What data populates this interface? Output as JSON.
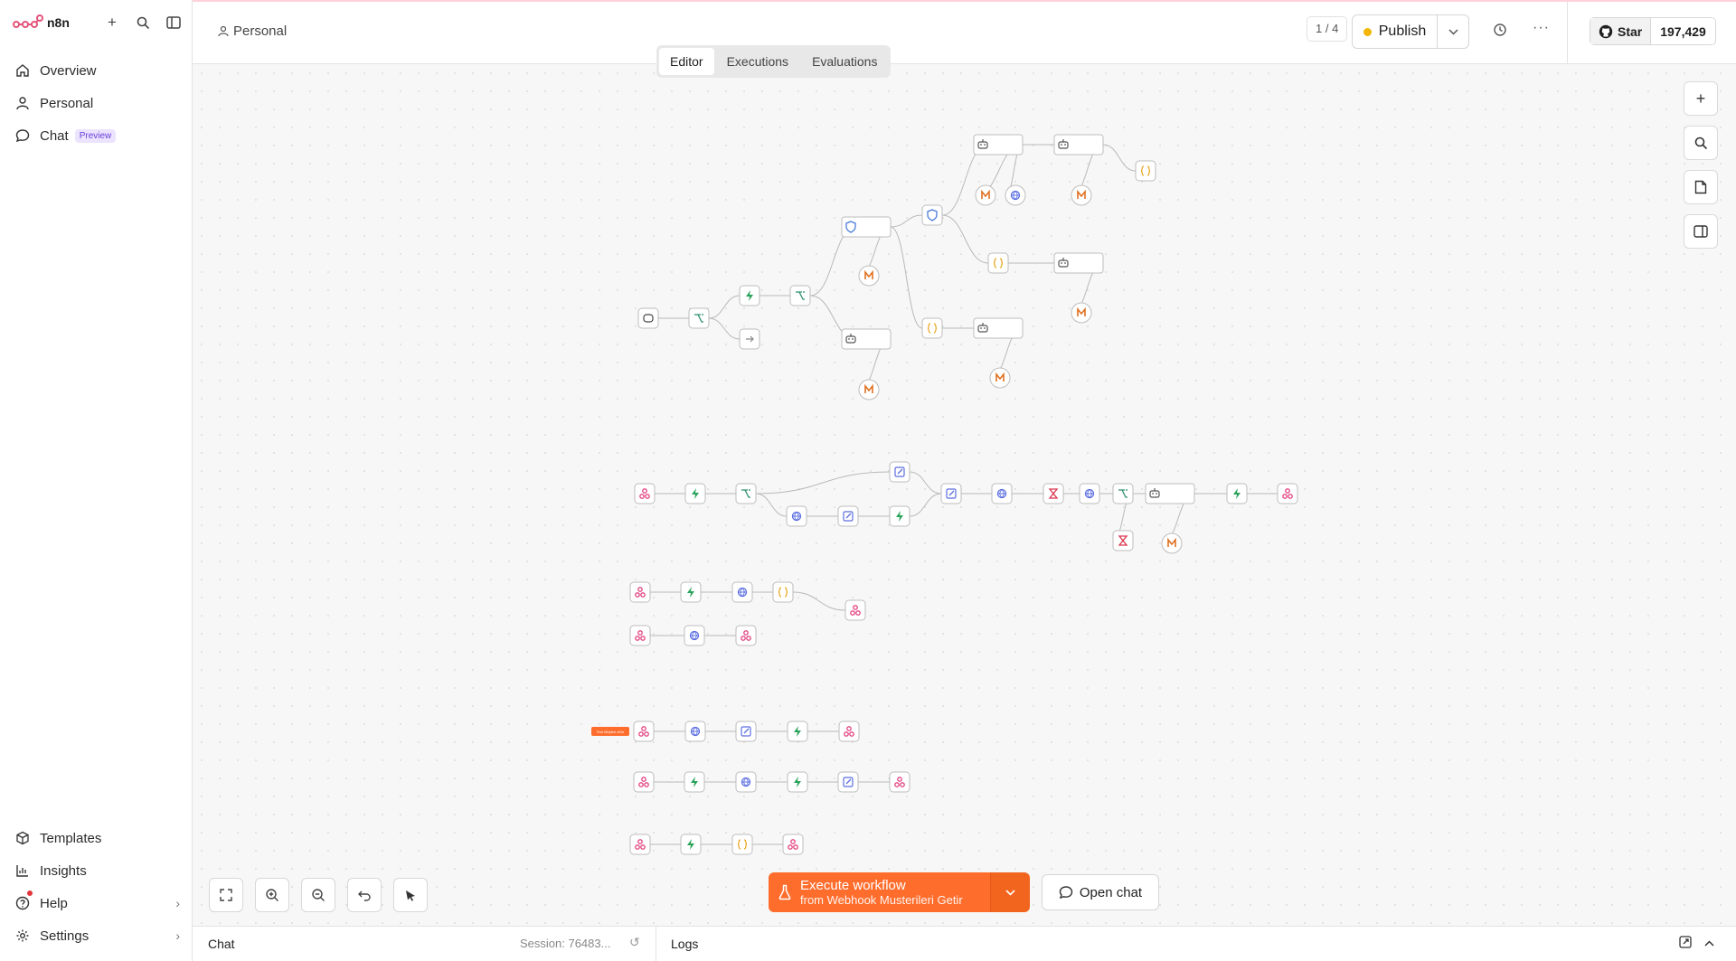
{
  "app": {
    "name": "n8n"
  },
  "sidebar": {
    "items": [
      {
        "label": "Overview",
        "icon": "home-icon"
      },
      {
        "label": "Personal",
        "icon": "user-icon"
      },
      {
        "label": "Chat",
        "icon": "chat-icon",
        "badge": "Preview"
      }
    ],
    "bottom_items": [
      {
        "label": "Templates",
        "icon": "box-icon"
      },
      {
        "label": "Insights",
        "icon": "bar-chart-icon"
      },
      {
        "label": "Help",
        "icon": "help-icon"
      },
      {
        "label": "Settings",
        "icon": "gear-icon"
      }
    ]
  },
  "header": {
    "breadcrumb": "Personal",
    "tabs": [
      "Editor",
      "Executions",
      "Evaluations"
    ],
    "active_tab": "Editor",
    "counter": "1 / 4",
    "publish_label": "Publish",
    "github_star_label": "Star",
    "github_star_count": "197,429"
  },
  "colors": {
    "accent": "#ff6d2d",
    "publish_dot": "#f2b600",
    "preview_badge": "#6b3fd8",
    "http_node": "#5b6ee1",
    "supabase_node": "#2aa35a",
    "webhook_node": "#e2417f",
    "model_node": "#e07020"
  },
  "workflow": {
    "sticky_note": "Test Müşteri eKle"
  },
  "actions": {
    "execute_title": "Execute workflow",
    "execute_sub": "from Webhook Musterileri Getir",
    "open_chat": "Open chat"
  },
  "bottom_panel": {
    "chat_label": "Chat",
    "session": "Session: 76483...",
    "logs_label": "Logs"
  }
}
